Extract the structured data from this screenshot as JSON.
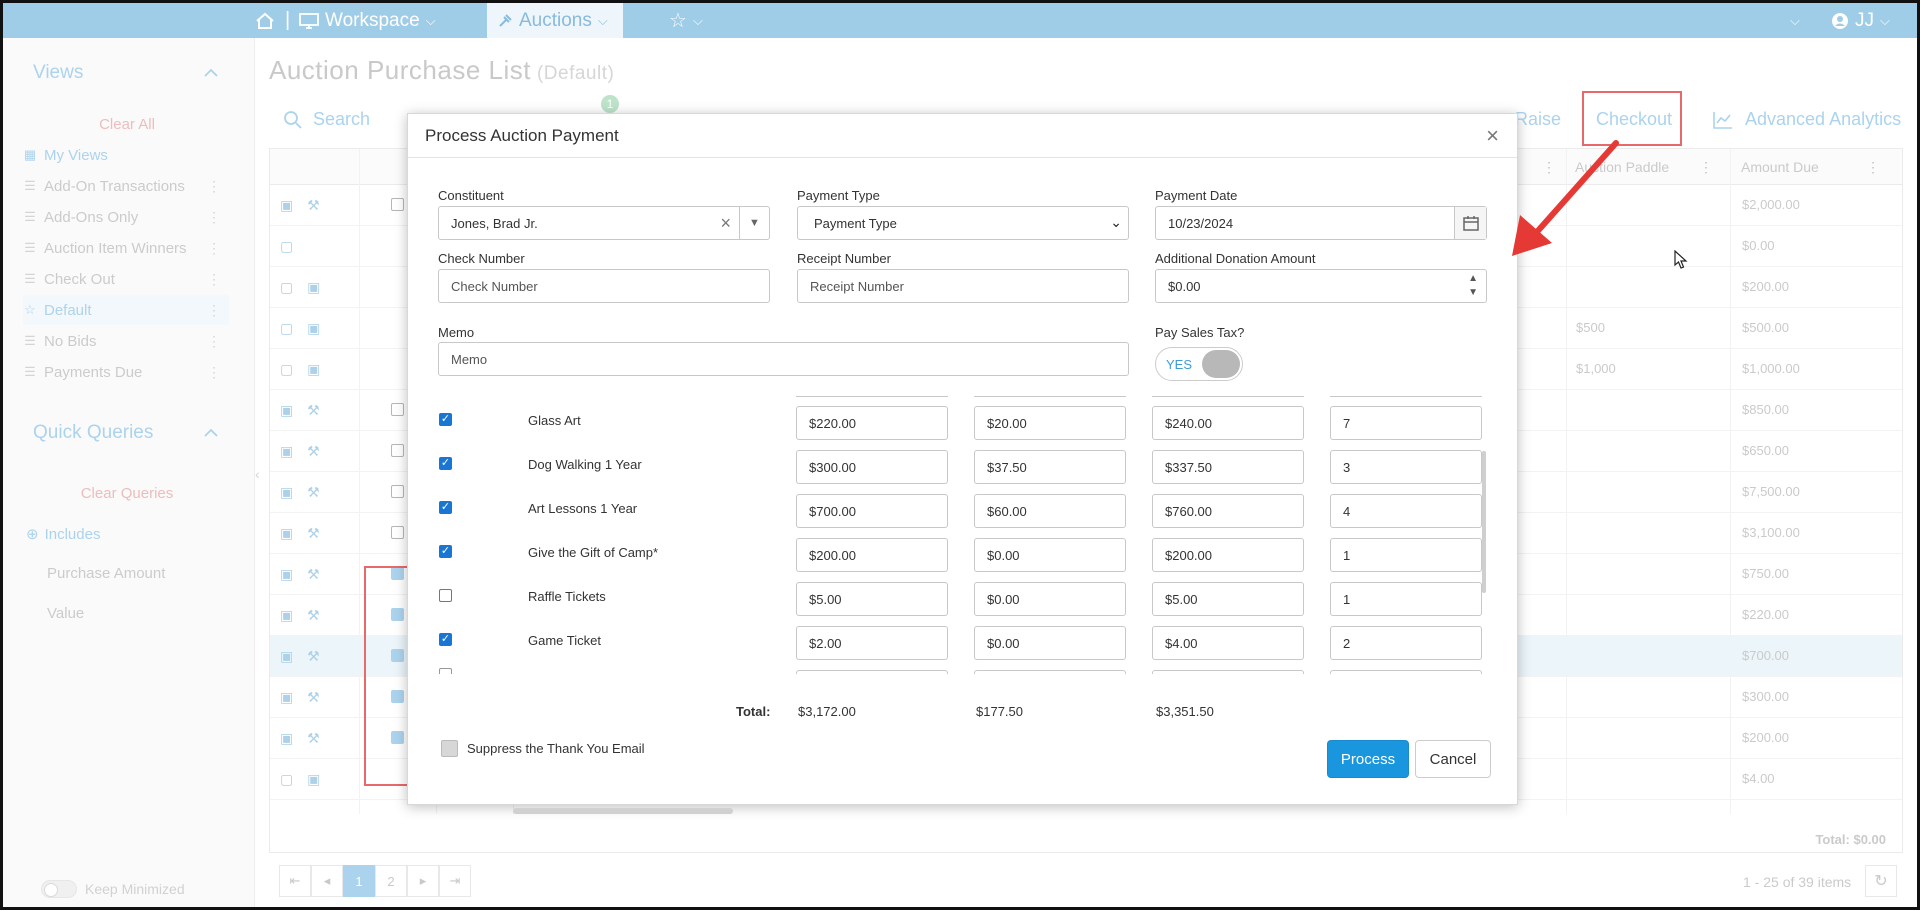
{
  "topbar": {
    "workspace": "Workspace",
    "auctions": "Auctions",
    "user": "JJ"
  },
  "sidebar": {
    "views_title": "Views",
    "clear_all": "Clear All",
    "items": [
      {
        "label": "My Views"
      },
      {
        "label": "Add-On Transactions"
      },
      {
        "label": "Add-Ons Only"
      },
      {
        "label": "Auction Item Winners"
      },
      {
        "label": "Check Out"
      },
      {
        "label": "Default"
      },
      {
        "label": "No Bids"
      },
      {
        "label": "Payments Due"
      }
    ],
    "quick_title": "Quick Queries",
    "clear_queries": "Clear Queries",
    "includes": "Includes",
    "queries": [
      "Purchase Amount",
      "Value"
    ],
    "keep_minimized": "Keep Minimized"
  },
  "page": {
    "title": "Auction Purchase List",
    "subtitle": "(Default)",
    "search": "Search",
    "raise": "Raise",
    "checkout": "Checkout",
    "analytics": "Advanced Analytics",
    "badge": "1"
  },
  "grid": {
    "col_paddle": "Auction Paddle",
    "col_amount": "Amount Due",
    "rows": [
      {
        "paddle": "",
        "amount": "$2,000.00"
      },
      {
        "paddle": "",
        "amount": "$0.00"
      },
      {
        "paddle": "",
        "amount": "$200.00"
      },
      {
        "paddle": "$500",
        "amount": "$500.00"
      },
      {
        "paddle": "$1,000",
        "amount": "$1,000.00"
      },
      {
        "paddle": "",
        "amount": "$850.00"
      },
      {
        "paddle": "",
        "amount": "$650.00"
      },
      {
        "paddle": "",
        "amount": "$7,500.00"
      },
      {
        "paddle": "",
        "amount": "$3,100.00"
      },
      {
        "paddle": "",
        "amount": "$750.00"
      },
      {
        "paddle": "",
        "amount": "$220.00"
      },
      {
        "paddle": "",
        "amount": "$700.00"
      },
      {
        "paddle": "",
        "amount": "$300.00"
      },
      {
        "paddle": "",
        "amount": "$200.00"
      },
      {
        "paddle": "",
        "amount": "$4.00"
      }
    ],
    "total": "Total: $0.00",
    "pages": [
      "1",
      "2"
    ],
    "items_count": "1 - 25 of 39 items"
  },
  "modal": {
    "title": "Process Auction Payment",
    "constituent_label": "Constituent",
    "constituent_value": "Jones, Brad Jr.",
    "payment_type_label": "Payment Type",
    "payment_type_value": "Payment Type",
    "payment_date_label": "Payment Date",
    "payment_date_value": "10/23/2024",
    "check_number_label": "Check Number",
    "check_number_placeholder": "Check Number",
    "receipt_number_label": "Receipt Number",
    "receipt_number_placeholder": "Receipt Number",
    "donation_label": "Additional Donation Amount",
    "donation_value": "$0.00",
    "memo_label": "Memo",
    "memo_placeholder": "Memo",
    "tax_label": "Pay Sales Tax?",
    "tax_toggle": "YES",
    "items": [
      {
        "name": "Glass Art",
        "checked": true,
        "c1": "$220.00",
        "c2": "$20.00",
        "c3": "$240.00",
        "c4": "7"
      },
      {
        "name": "Dog Walking 1 Year",
        "checked": true,
        "c1": "$300.00",
        "c2": "$37.50",
        "c3": "$337.50",
        "c4": "3"
      },
      {
        "name": "Art Lessons 1 Year",
        "checked": true,
        "c1": "$700.00",
        "c2": "$60.00",
        "c3": "$760.00",
        "c4": "4"
      },
      {
        "name": "Give the Gift of Camp*",
        "checked": true,
        "c1": "$200.00",
        "c2": "$0.00",
        "c3": "$200.00",
        "c4": "1"
      },
      {
        "name": "Raffle Tickets",
        "checked": false,
        "c1": "$5.00",
        "c2": "$0.00",
        "c3": "$5.00",
        "c4": "1"
      },
      {
        "name": "Game Ticket",
        "checked": true,
        "c1": "$2.00",
        "c2": "$0.00",
        "c3": "$4.00",
        "c4": "2"
      }
    ],
    "total_label": "Total:",
    "total_1": "$3,172.00",
    "total_2": "$177.50",
    "total_3": "$3,351.50",
    "suppress": "Suppress the Thank You Email",
    "process": "Process",
    "cancel": "Cancel"
  }
}
